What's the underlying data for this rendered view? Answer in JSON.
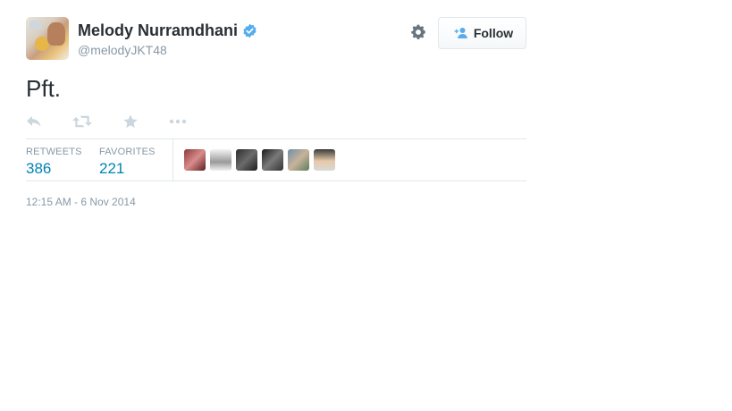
{
  "user": {
    "name": "Melody Nurramdhani",
    "handle": "@melodyJKT48",
    "verified_icon": "verified-badge-icon"
  },
  "header": {
    "follow_label": "Follow",
    "settings_icon": "gear-icon"
  },
  "tweet": {
    "text": "Pft.",
    "timestamp": "12:15 AM - 6 Nov 2014"
  },
  "actions": [
    "reply-icon",
    "retweet-icon",
    "favorite-icon",
    "more-icon"
  ],
  "stats": {
    "retweets_label": "RETWEETS",
    "retweets_value": "386",
    "favorites_label": "FAVORITES",
    "favorites_value": "221"
  },
  "colors": {
    "link": "#0084b4",
    "muted": "#8899a6",
    "verified": "#55acee",
    "text": "#292f33"
  }
}
